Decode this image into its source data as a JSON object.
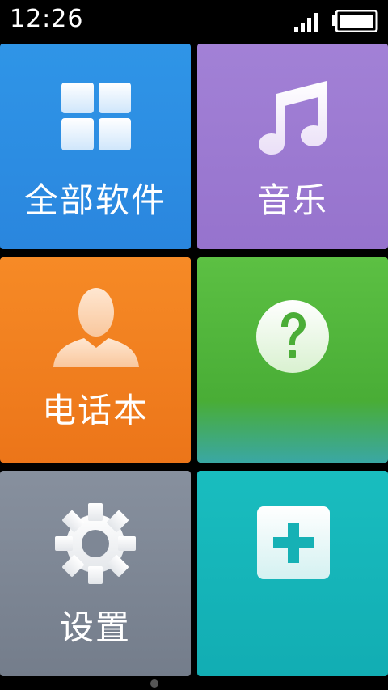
{
  "status_bar": {
    "time": "12:26"
  },
  "tiles": [
    {
      "label": "全部软件",
      "icon": "grid-icon",
      "color": "#2f95e7"
    },
    {
      "label": "音乐",
      "icon": "music-note-icon",
      "color": "#9d7bd3"
    },
    {
      "label": "电话本",
      "icon": "person-icon",
      "color": "#f2801f"
    },
    {
      "label": "",
      "icon": "help-question-icon",
      "color": "#52b83c"
    },
    {
      "label": "设置",
      "icon": "gear-icon",
      "color": "#7e8795"
    },
    {
      "label": "",
      "icon": "add-plus-icon",
      "color": "#17b6ba"
    }
  ]
}
